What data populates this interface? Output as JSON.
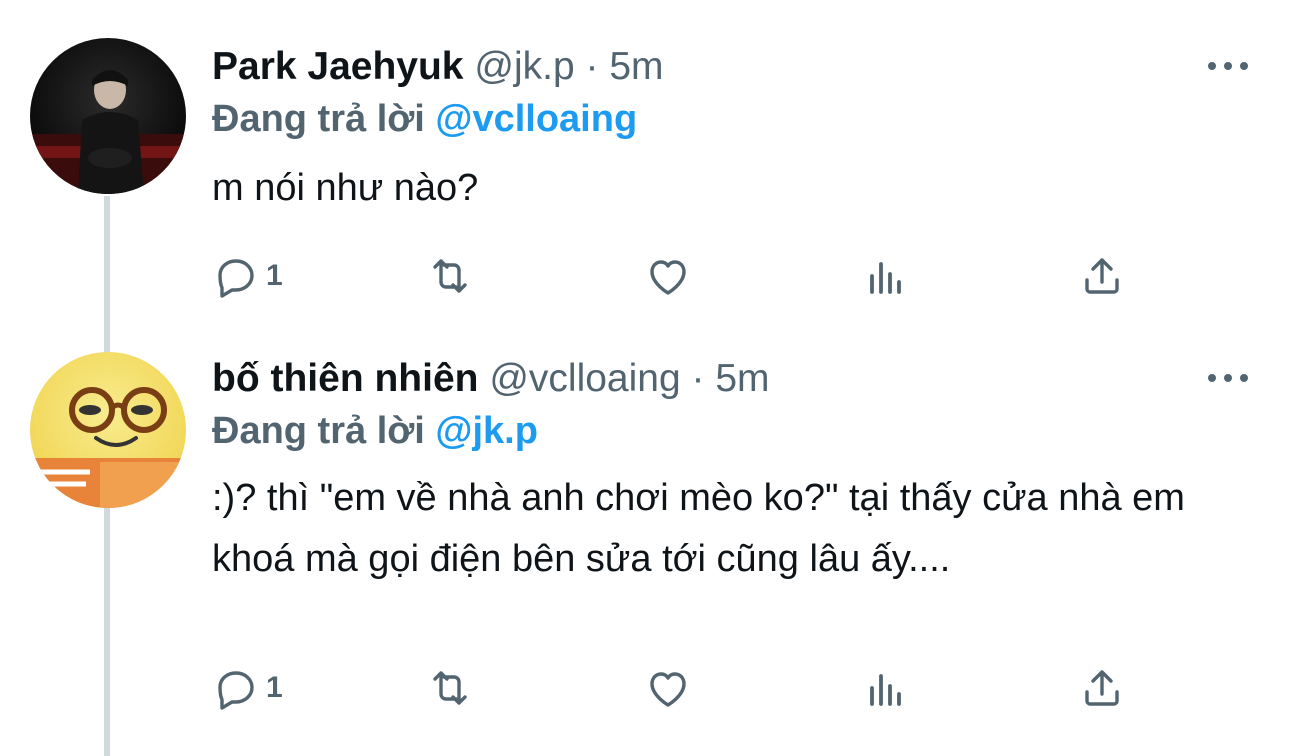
{
  "colors": {
    "text": "#0f1419",
    "muted": "#536471",
    "accent": "#1d9bf0",
    "thread_line": "#cfd9de"
  },
  "tweets": [
    {
      "name": "Park Jaehyuk",
      "handle": "@jk.p",
      "separator": "·",
      "time": "5m",
      "replying_label": "Đang trả lời",
      "replying_to": "@vclloaing",
      "text": "m nói như nào?",
      "reply_count": "1",
      "avatar_icon": "user-photo-dark"
    },
    {
      "name": "bố thiên nhiên",
      "handle": "@vclloaing",
      "separator": "·",
      "time": "5m",
      "replying_label": "Đang trả lời",
      "replying_to": "@jk.p",
      "text": ":)? thì \"em về nhà anh chơi mèo ko?\" tại thấy cửa nhà em khoá mà gọi điện bên sửa tới cũng lâu ấy....",
      "reply_count": "1",
      "avatar_icon": "yellow-plush-with-glasses"
    }
  ],
  "icons": [
    "reply-icon",
    "retweet-icon",
    "like-icon",
    "views-icon",
    "share-icon",
    "more-options-icon"
  ]
}
